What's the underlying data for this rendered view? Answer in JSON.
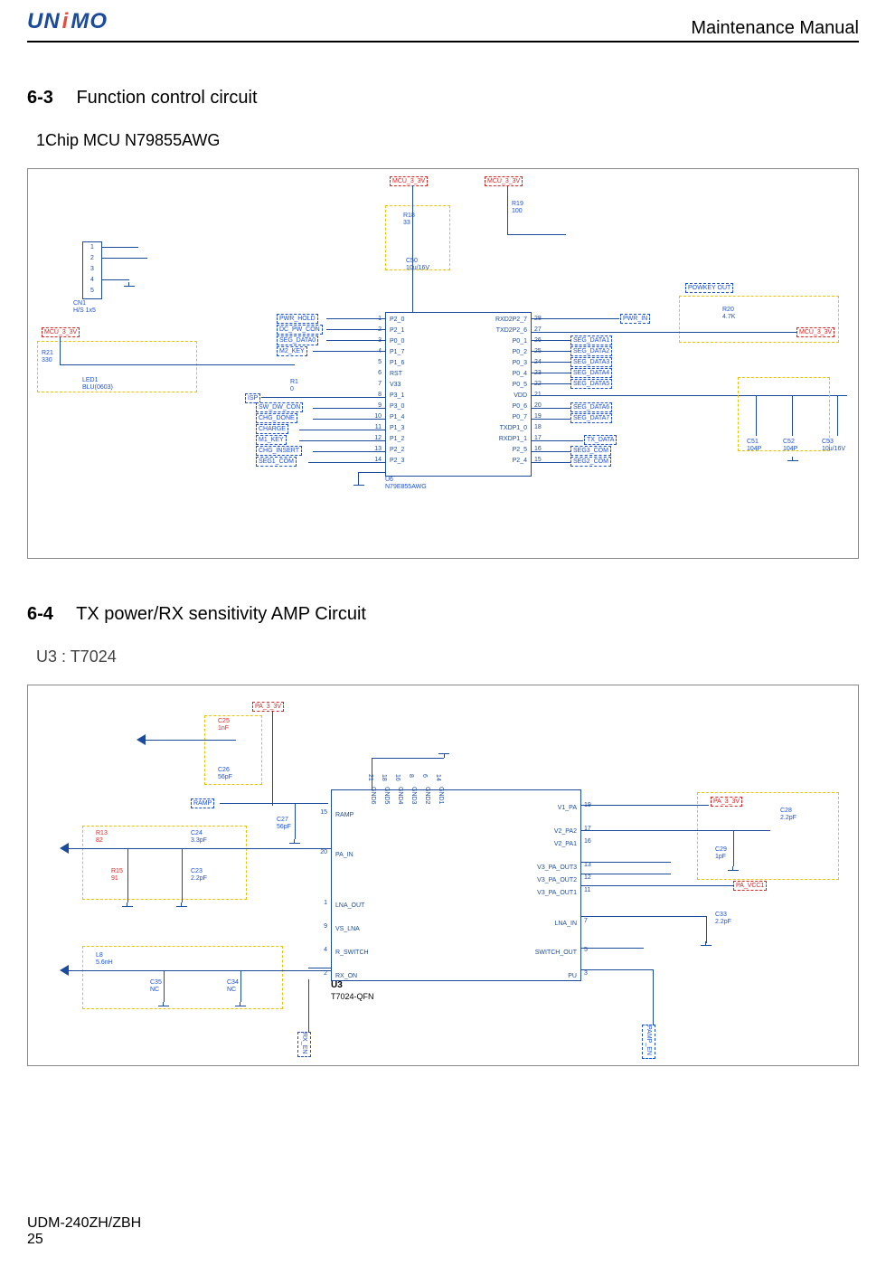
{
  "header": {
    "logo": "UNIMO",
    "title": "Maintenance Manual"
  },
  "section1": {
    "num": "6-3",
    "title": "Function control circuit",
    "sub": "1Chip MCU N79855AWG"
  },
  "diagram1": {
    "pwr_rails": [
      "MCU_3_3V",
      "MCU_3_3V",
      "MCU_3_3V",
      "MCU_3_3V"
    ],
    "conn": {
      "ref": "CN1",
      "desc": "H/S 1x5",
      "pins": [
        "1",
        "2",
        "3",
        "4",
        "5"
      ]
    },
    "left_led": {
      "r": "R21",
      "rv": "330",
      "led": "LED1",
      "ledc": "BLU(0603)"
    },
    "r18": {
      "ref": "R18",
      "val": "33"
    },
    "r19": {
      "ref": "R19",
      "val": "100"
    },
    "c50": {
      "ref": "C50",
      "val": "10u/16V"
    },
    "r20box": {
      "label": "POWKEY OUT",
      "r": "R20",
      "rv": "4.7K"
    },
    "isp": "ISP",
    "r1": {
      "ref": "R1",
      "val": "0"
    },
    "left_tags": [
      "PWR_HOLD",
      "DC_PW_CON",
      "SEG_DATA0",
      "M2_KEY"
    ],
    "left_tags2": [
      "SW_DW_CON",
      "CHG_DONE",
      "CHARGE",
      "M1_KEY",
      "CHG_INSERT",
      "SEG1_COM"
    ],
    "right_top": "PWR_IN",
    "right_tags": [
      "SEG_DATA1",
      "SEG_DATA2",
      "SEG_DATA3",
      "SEG_DATA4",
      "SEG_DATA5"
    ],
    "right_tags2": [
      "SEG_DATA6",
      "SEG_DATA7"
    ],
    "right_tags3": [
      "TX_DATA",
      "SEG3_COM",
      "SEG2_COM"
    ],
    "ic": {
      "ref": "U6",
      "part": "N79E855AWG",
      "left_pins": [
        "P2_0",
        "P2_1",
        "P0_0",
        "P1_7",
        "P1_6",
        "RST",
        "V33",
        "P3_1",
        "P3_0",
        "P1_4",
        "P1_3",
        "P1_2",
        "P2_2",
        "P2_3"
      ],
      "left_nums": [
        "1",
        "2",
        "3",
        "4",
        "5",
        "6",
        "7",
        "8",
        "9",
        "10",
        "11",
        "12",
        "13",
        "14"
      ],
      "right_pins": [
        "RXD2P2_7",
        "TXD2P2_6",
        "P0_1",
        "P0_2",
        "P0_3",
        "P0_4",
        "P0_5",
        "VDD",
        "P0_6",
        "P0_7",
        "TXDP1_0",
        "RXDP1_1",
        "P2_5",
        "P2_4"
      ],
      "right_nums": [
        "28",
        "27",
        "26",
        "25",
        "24",
        "23",
        "22",
        "21",
        "20",
        "19",
        "18",
        "17",
        "16",
        "15"
      ],
      "c51": {
        "ref": "C51",
        "val": "104P"
      },
      "c52": {
        "ref": "C52",
        "val": "104P"
      },
      "c53": {
        "ref": "C53",
        "val": "10u/16V"
      }
    }
  },
  "section2": {
    "num": "6-4",
    "title": "TX power/RX sensitivity AMP Circuit",
    "sub": "U3 : T7024"
  },
  "diagram2": {
    "top_tag": "PA_3_3V",
    "c25": {
      "ref": "C25",
      "val": "1nF"
    },
    "c26": {
      "ref": "C26",
      "val": "56pF"
    },
    "ramp": "RAMP",
    "r13": {
      "ref": "R13",
      "val": "82"
    },
    "c24": {
      "ref": "C24",
      "val": "3.3pF"
    },
    "r15": {
      "ref": "R15",
      "val": "91"
    },
    "c23": {
      "ref": "C23",
      "val": "2.2pF"
    },
    "c27": {
      "ref": "C27",
      "val": "56pF"
    },
    "l8": {
      "ref": "L8",
      "val": "5.6nH"
    },
    "c35": {
      "ref": "C35",
      "val": "NC"
    },
    "c34": {
      "ref": "C34",
      "val": "NC"
    },
    "rx_en": "RX_EN",
    "pamp_en": "PAMP_EN",
    "right_top": "PA_3_3V",
    "c28": {
      "ref": "C28",
      "val": "2.2pF"
    },
    "c29": {
      "ref": "C29",
      "val": "1pF"
    },
    "pa_vcc": "PA_VCC1",
    "c33": {
      "ref": "C33",
      "val": "2.2pF"
    },
    "ic": {
      "ref": "U3",
      "part": "T7024-QFN",
      "top_pins": [
        "GND6",
        "GND5",
        "GND4",
        "GND3",
        "GND2",
        "GND1"
      ],
      "top_nums": [
        "21",
        "18",
        "16",
        "8",
        "6",
        "14"
      ],
      "left_pins": [
        "RAMP",
        "PA_IN",
        "LNA_OUT",
        "VS_LNA",
        "R_SWITCH",
        "RX_ON"
      ],
      "left_nums": [
        "15",
        "20",
        "1",
        "9",
        "4",
        "2"
      ],
      "right_pins": [
        "V1_PA",
        "V2_PA2",
        "V2_PA1",
        "V3_PA_OUT3",
        "V3_PA_OUT2",
        "V3_PA_OUT1",
        "LNA_IN",
        "SWITCH_OUT",
        "PU"
      ],
      "right_nums": [
        "19",
        "17",
        "16",
        "13",
        "12",
        "11",
        "7",
        "5",
        "3"
      ]
    }
  },
  "footer": {
    "model": "UDM-240ZH/ZBH",
    "page": "25"
  }
}
